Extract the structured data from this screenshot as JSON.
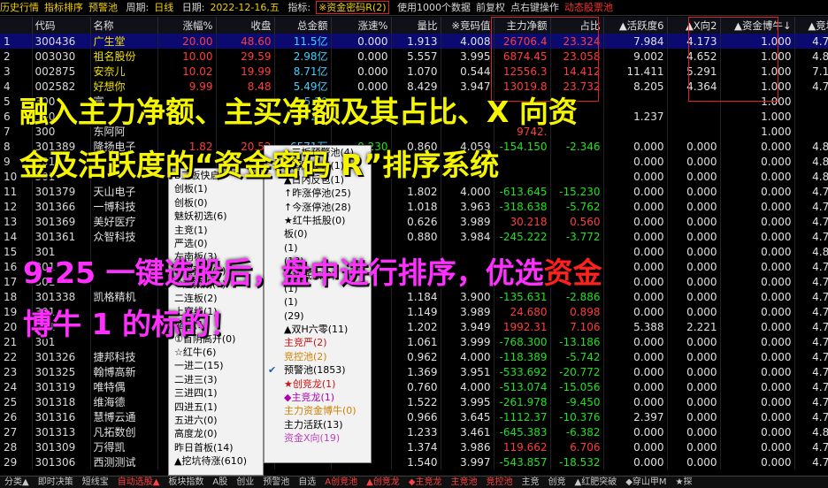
{
  "topbar": {
    "history": "历史行情",
    "sort": "指标排序",
    "warn": "预警池",
    "period_label": "周期:",
    "period_val": "日线",
    "date_label": "日期:",
    "date_val": "2022-12-16,五",
    "indicator_label": "指标:",
    "indicator_val": "※资金密码R(2)",
    "use_data": "使用1000个数据",
    "fq": "前复权",
    "right_click": "点右键操作",
    "dynamic_pool": "动态股票池"
  },
  "columns": [
    "",
    "代码",
    "名称",
    "涨幅%",
    "收盘",
    "总金额",
    "涨速%",
    "量比",
    "※竞码值",
    "主力净额",
    "占比",
    "▲活跃度6",
    "▲X向2",
    "▲资金博牛↓",
    "▲竞块5"
  ],
  "rows": [
    [
      "1",
      "300436",
      "广生堂",
      "20.00",
      "48.60",
      "11.5亿",
      "0.000",
      "1.913",
      "4.008",
      "26706.4",
      "23.324",
      "7.984",
      "4.173",
      "1.000",
      "4.744"
    ],
    [
      "2",
      "003030",
      "祖名股份",
      "10.00",
      "29.59",
      "2.98亿",
      "0.000",
      "5.557",
      "3.995",
      "6874.45",
      "23.058",
      "9.002",
      "4.652",
      "1.000",
      "4.816"
    ],
    [
      "3",
      "002875",
      "安奈儿",
      "10.02",
      "19.99",
      "8.71亿",
      "0.000",
      "1.070",
      "0.544",
      "12556.3",
      "14.412",
      "11.411",
      "5.291",
      "1.000",
      "7.123"
    ],
    [
      "4",
      "002582",
      "好想你",
      "9.99",
      "8.48",
      "5.49亿",
      "0.000",
      "8.429",
      "3.947",
      "13019.8",
      "23.732",
      "8.205",
      "4.364",
      "1.000",
      "4.744"
    ],
    [
      "5",
      "300",
      "富",
      "",
      "",
      "5.50",
      "",
      "",
      "",
      "",
      "",
      "",
      "",
      "1.000",
      ""
    ],
    [
      "6",
      "300",
      "",
      "",
      "",
      "12.5",
      "",
      "",
      "",
      "",
      "",
      "1.237",
      "",
      "1.000",
      ""
    ],
    [
      "7",
      "300",
      "东阿阿",
      "",
      "",
      "",
      "",
      "",
      "",
      "9742.",
      "",
      "",
      "",
      "1.000",
      ""
    ],
    [
      "8",
      "301389",
      "隆扬电子",
      "1.82",
      "20.52",
      "6571万",
      "-0.230",
      "0.860",
      "4.059",
      "-154.150",
      "-2.346",
      "0.000",
      "0.000",
      "0.000",
      "4.823"
    ],
    [
      "9",
      "301",
      "",
      "",
      "",
      "",
      "",
      "",
      "",
      "",
      "",
      "0.000",
      "0.000",
      "0.000",
      "4.807"
    ],
    [
      "10",
      "301",
      "",
      "",
      "",
      "",
      "",
      "",
      "",
      "",
      "",
      "0.000",
      "0.000",
      "0.000",
      "4.816"
    ],
    [
      "11",
      "301379",
      "天山电子",
      "",
      "",
      "",
      "",
      "1.802",
      "4.000",
      "-613.645",
      "-15.230",
      "0.000",
      "0.000",
      "0.000",
      "4.700"
    ],
    [
      "12",
      "301366",
      "一博科技",
      "",
      "",
      "",
      "",
      "1.018",
      "3.963",
      "-318.638",
      "-5.762",
      "0.000",
      "0.000",
      "0.000",
      "4.781"
    ],
    [
      "13",
      "301369",
      "美好医疗",
      "",
      "",
      "",
      "",
      "0.626",
      "3.989",
      "30.218",
      "0.560",
      "0.000",
      "0.000",
      "0.000",
      "4.719"
    ],
    [
      "14",
      "301361",
      "众智科技",
      "",
      "",
      "",
      "",
      "0.880",
      "3.984",
      "-245.222",
      "-3.772",
      "0.000",
      "0.000",
      "0.000",
      "4.721"
    ],
    [
      "15",
      "301",
      "",
      "",
      "",
      "",
      "",
      "",
      "",
      "",
      "",
      "0.000",
      "0.000",
      "0.000",
      "4.856"
    ],
    [
      "16",
      "301",
      "",
      "",
      "",
      "",
      "",
      "",
      "",
      "",
      "",
      "0.000",
      "0.000",
      "0.000",
      "4.756"
    ],
    [
      "17",
      "301",
      "",
      "",
      "",
      "",
      "",
      "",
      "",
      "",
      "",
      "0.000",
      "0.000",
      "0.000",
      "4.736"
    ],
    [
      "18",
      "301338",
      "凯格精机",
      "",
      "",
      "",
      "",
      "1.184",
      "3.900",
      "-135.631",
      "-2.886",
      "0.000",
      "0.000",
      "0.000",
      "4.756"
    ],
    [
      "19",
      "301",
      "",
      "",
      "",
      "",
      "",
      "1.149",
      "3.989",
      "24.680",
      "0.898",
      "0.000",
      "0.000",
      "0.000",
      "4.736"
    ],
    [
      "20",
      "301",
      "",
      "",
      "",
      "",
      "",
      "1.202",
      "3.949",
      "1992.31",
      "7.106",
      "5.388",
      "2.221",
      "0.000",
      "4.756"
    ],
    [
      "21",
      "301",
      "",
      "",
      "",
      "",
      "",
      "1.061",
      "3.999",
      "-768.300",
      "-13.186",
      "0.000",
      "0.000",
      "0.000",
      "4.700"
    ],
    [
      "22",
      "301326",
      "捷邦科技",
      "",
      "",
      "",
      "",
      "0.962",
      "4.000",
      "-118.389",
      "-5.742",
      "0.000",
      "0.000",
      "0.000",
      "4.700"
    ],
    [
      "23",
      "301325",
      "翰博高新",
      "",
      "",
      "",
      "",
      "1.369",
      "3.951",
      "-533.692",
      "-20.772",
      "0.000",
      "0.000",
      "0.000",
      "4.737"
    ],
    [
      "24",
      "301319",
      "唯特偶",
      "",
      "",
      "",
      "",
      "0.760",
      "4.000",
      "-513.074",
      "-15.056",
      "0.000",
      "0.000",
      "0.000",
      "4.700"
    ],
    [
      "25",
      "301318",
      "维海德",
      "",
      "",
      "",
      "",
      "1.522",
      "3.995",
      "-261.978",
      "-9.450",
      "0.000",
      "0.000",
      "0.000",
      "4.700"
    ],
    [
      "26",
      "301316",
      "慧博云通",
      "",
      "",
      "",
      "",
      "0.966",
      "3.645",
      "-1112.37",
      "-10.376",
      "2.397",
      "0.000",
      "0.000",
      "4.700"
    ],
    [
      "27",
      "301313",
      "凡拓数创",
      "",
      "",
      "",
      "",
      "1.233",
      "3.461",
      "-645.383",
      "-6.382",
      "0.000",
      "0.000",
      "0.000",
      "4.891"
    ],
    [
      "28",
      "301309",
      "万得凯",
      "",
      "",
      "",
      "",
      "1.374",
      "3.986",
      "119.662",
      "6.706",
      "0.000",
      "0.000",
      "0.000",
      "4.726"
    ],
    [
      "29",
      "301306",
      "西测测试",
      "",
      "",
      "",
      "",
      "1.540",
      "3.997",
      "-543.857",
      "-18.532",
      "0.000",
      "0.000",
      "0.000",
      "4.700"
    ]
  ],
  "popup1": [
    "B三板快启",
    "创板(1)",
    "创板(0)",
    "魅妖初选(6)",
    "主竞(1)",
    "严选(0)",
    "左南板(3)",
    "②超预期(1)",
    "①超预期(1)",
    "二连板(2)",
    "上穿线(1)",
    "缩量(1)",
    "①首阴高开(0)",
    "☆红牛(6)",
    "一进二(15)",
    "二进三(3)",
    "三进四(1)",
    "四进五(1)",
    "五进六(0)",
    "高度龙(0)",
    "昨日首板(14)",
    "▲挖坑待涨(610)"
  ],
  "popup2": [
    "▲三板预警池(4)",
    "▲首阴反包(1)",
    "▲日内反包(1)",
    "↑昨涨停池(25)",
    "↑今涨停池(28)",
    "★红牛抵股(0)",
    "板(0)",
    "(1)",
    "(18)",
    "★探底点(0)",
    "(1)",
    "(1)",
    "(29)",
    "▲双H六零(11)",
    "主竞严(2)",
    "竞控池(2)",
    "预警池(1853)",
    "★创竞龙(1)",
    "◆主竞龙(1)",
    "主力资金博牛(0)",
    "主力活跃(13)",
    "资金X向(19)"
  ],
  "popup2_checked_index": 16,
  "overlay": {
    "line1": "融入主力净额、主买净额及其占比、X 向资",
    "line2": "金及活跃度的“资金密码 R”排序系统",
    "line3a": "9:25 一键选股后，盘中进行排序，优选",
    "line3b": "资金",
    "line4": "博牛 1 的标的！"
  },
  "tabbar": [
    "分类▲",
    "即时决策",
    "短线宝",
    "自动选股▲",
    "板块指数",
    "A股",
    "创业",
    "预警池",
    "自选",
    "A创竞池",
    "▲创竞龙",
    "◆主竞龙",
    "主竞池",
    "竞控池",
    "主竞",
    "创竞",
    "▲红肥突破",
    "◆穿山甲M",
    "★探"
  ]
}
